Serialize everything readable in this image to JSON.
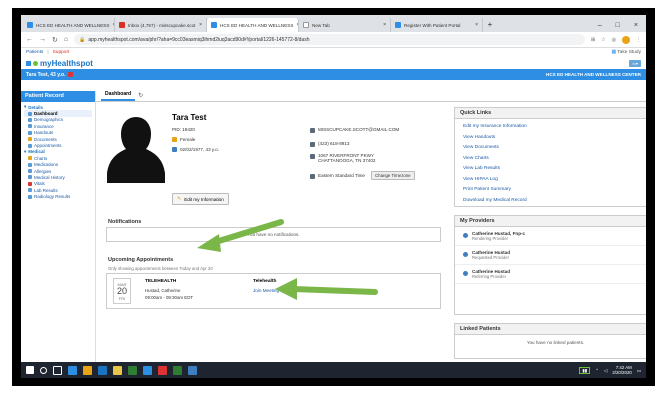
{
  "browser": {
    "tabs": [
      {
        "label": "HCS ED HEALTH AND WELLNESS",
        "color": "#2d8ee3",
        "active": false
      },
      {
        "label": "Inbox (4,757) - misscupcake.scot",
        "color": "#d93025",
        "active": false
      },
      {
        "label": "HCS ED HEALTH AND WELLNESS",
        "color": "#2d8ee3",
        "active": true
      },
      {
        "label": "New Tab",
        "color": "#ffffff",
        "active": false
      },
      {
        "label": "Register With Patient Portal",
        "color": "#2d8ee3",
        "active": false
      }
    ],
    "url": "app.myhealthspot.com/ava/phr/?aha=9cc03easmiq3ihmd2iuq3acd90d#!/portal/1226-145772-8/dash",
    "bookmarks": [
      "Patients",
      "Support"
    ],
    "task_label": "Take Study"
  },
  "app": {
    "logo": "myHealthspot",
    "patient_label": "Tara Test, 43 y.o.",
    "clinic": "HCS ED HEALTH AND WELLNESS CENTER"
  },
  "sidebar": {
    "title": "Patient Record",
    "items": [
      {
        "label": "Details",
        "type": "group"
      },
      {
        "label": "Dashboard",
        "type": "current"
      },
      {
        "label": "Demographics",
        "type": "item"
      },
      {
        "label": "Insurance",
        "type": "item"
      },
      {
        "label": "Handouts",
        "type": "item"
      },
      {
        "label": "Documents",
        "type": "item"
      },
      {
        "label": "Appointments",
        "type": "item"
      },
      {
        "label": "Medical",
        "type": "group"
      },
      {
        "label": "Charts",
        "type": "item"
      },
      {
        "label": "Medications",
        "type": "item"
      },
      {
        "label": "Allergies",
        "type": "item"
      },
      {
        "label": "Medical History",
        "type": "item"
      },
      {
        "label": "Vitals",
        "type": "item"
      },
      {
        "label": "Lab Results",
        "type": "item"
      },
      {
        "label": "Radiology Results",
        "type": "item"
      }
    ]
  },
  "main": {
    "tab": "Dashboard",
    "patient": {
      "name": "Tara Test",
      "pid": "PID: 19420",
      "gender": "Female",
      "dob": "02/02/1977, 43 y.o.",
      "email": "MISSCUPCAKE.SCOTT@GMAIL.COM",
      "phone": "(423) 618-8913",
      "address_line1": "1067 RIVERFRONT PKWY",
      "address_line2": "CHATTANOOGA, TN 37402",
      "timezone": "Eastern Standard Time",
      "change_tz": "Change Timezone",
      "edit_button": "Edit my Information"
    },
    "notifications_title": "Notifications",
    "notifications_empty": "You have no notifications.",
    "upcoming_title": "Upcoming Appointments",
    "upcoming_subtitle": "Only showing appointments between Today and Apr 20",
    "appointment": {
      "month": "MAR",
      "day": "20",
      "weekday": "FRI",
      "type": "TELEHEALTH",
      "provider": "Hustad, Catherine",
      "time": "09:00am - 09:30am EDT",
      "mode": "Telehealth",
      "join": "Join Meeting"
    }
  },
  "quick_links": {
    "title": "Quick Links",
    "links": [
      "Edit my Insurance Information",
      "View Handouts",
      "View Documents",
      "View Charts",
      "View Lab Results",
      "View HIPAA Log",
      "Print Patient Summary",
      "Download my Medical Record"
    ]
  },
  "providers": {
    "title": "My Providers",
    "items": [
      {
        "name": "Catherine Hustad, Fnp-c",
        "role": "Rendering Provider"
      },
      {
        "name": "Catherine Hustad",
        "role": "Requested Provider"
      },
      {
        "name": "Catherine Hustad",
        "role": "Referring Provider"
      }
    ]
  },
  "linked": {
    "title": "Linked Patients",
    "empty": "You have no linked patients."
  },
  "taskbar": {
    "time": "7:42 AM",
    "date": "3/20/2020"
  },
  "colors": {
    "brand_blue": "#2d8ee3",
    "arrow_green": "#7ab648",
    "link_blue": "#1a5aa6"
  }
}
